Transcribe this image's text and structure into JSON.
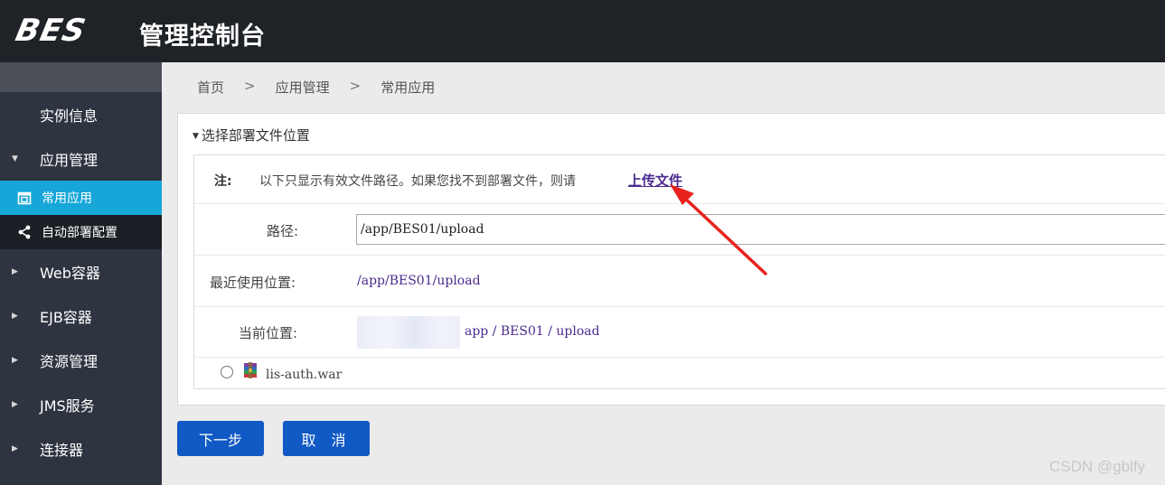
{
  "header": {
    "logo": "BES",
    "title": "管理控制台"
  },
  "sidebar": {
    "items": [
      {
        "label": "实例信息",
        "arrow": ""
      },
      {
        "label": "应用管理",
        "arrow": "▼"
      },
      {
        "label": "常用应用",
        "sub": true,
        "active": true,
        "icon": "app-icon"
      },
      {
        "label": "自动部署配置",
        "sub": true,
        "icon": "share-icon"
      },
      {
        "label": "Web容器",
        "arrow": "▶"
      },
      {
        "label": "EJB容器",
        "arrow": "▶"
      },
      {
        "label": "资源管理",
        "arrow": "▶"
      },
      {
        "label": "JMS服务",
        "arrow": "▶"
      },
      {
        "label": "连接器",
        "arrow": "▶"
      }
    ]
  },
  "breadcrumb": {
    "home": "首页",
    "sep": ">",
    "section": "应用管理",
    "page": "常用应用"
  },
  "panel": {
    "title": "选择部署文件位置",
    "toggle": "▼",
    "note_label": "注:",
    "note_text": "以下只显示有效文件路径。如果您找不到部署文件，则请",
    "upload_link": "上传文件",
    "path_label": "路径:",
    "path_value": "/app/BES01/upload",
    "recent_label": "最近使用位置:",
    "recent_value": "/app/BES01/upload",
    "current_label": "当前位置:",
    "current_path": "app / BES01 / upload",
    "file_name": "lis-auth.war"
  },
  "buttons": {
    "next": "下一步",
    "cancel": "取 消"
  },
  "watermark": "CSDN @gblfy",
  "colors": {
    "accent": "#16a7d8",
    "button": "#1159c4",
    "link": "#4b2a8e",
    "annotation": "#e8231e"
  }
}
